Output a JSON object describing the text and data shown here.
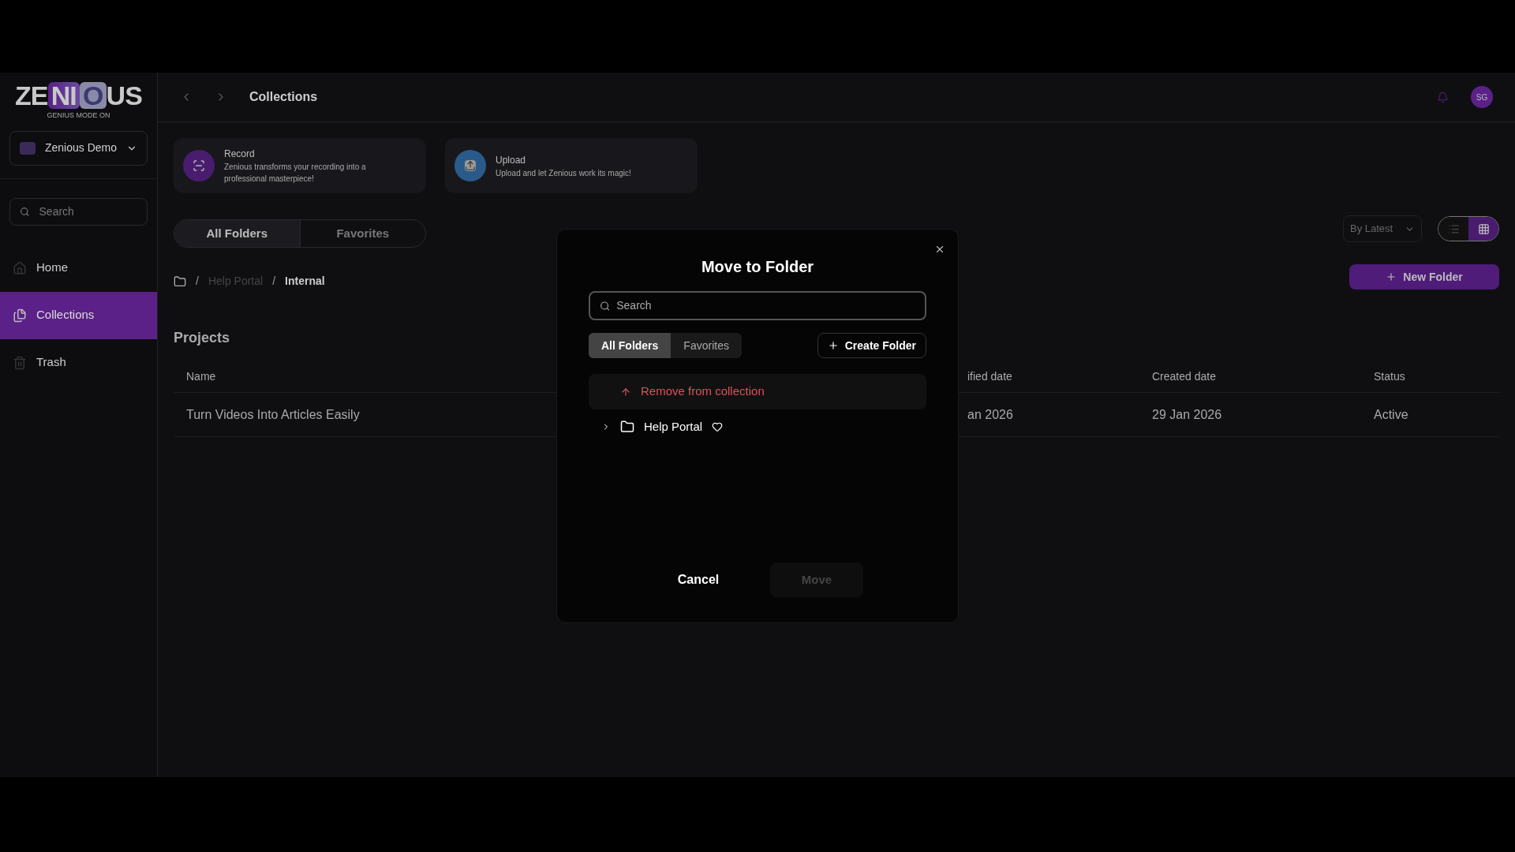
{
  "brand": {
    "name": "ZENIOUS",
    "tagline": "GENIUS MODE ON"
  },
  "workspace": {
    "name": "Zenious Demo"
  },
  "sidebar": {
    "search": {
      "placeholder": "Search"
    },
    "items": [
      {
        "label": "Home",
        "kind": "home",
        "selected": false
      },
      {
        "label": "Collections",
        "kind": "collections",
        "selected": true
      },
      {
        "label": "Trash",
        "kind": "trash",
        "selected": false
      }
    ]
  },
  "header": {
    "title": "Collections",
    "avatar": "SG"
  },
  "actions": [
    {
      "kind": "record",
      "title": "Record",
      "text": "Zenious transforms your recording into a professional masterpiece!"
    },
    {
      "kind": "upload",
      "title": "Upload",
      "text": "Upload and let Zenious work its magic!"
    }
  ],
  "folder_tabs": [
    {
      "label": "All Folders",
      "selected": true
    },
    {
      "label": "Favorites",
      "selected": false
    }
  ],
  "breadcrumb": [
    {
      "separator": "/",
      "label": "Help Portal",
      "current": false
    },
    {
      "separator": "/",
      "label": "Internal",
      "current": true
    }
  ],
  "sort": {
    "value": "By Latest"
  },
  "view_toggle": [
    {
      "kind": "list",
      "selected": false
    },
    {
      "kind": "grid",
      "selected": true
    }
  ],
  "new_folder": "New Folder",
  "section_title": "Projects",
  "table": {
    "columns": [
      "Name",
      "ified date",
      "Created date",
      "Status"
    ],
    "rows": [
      [
        "Turn Videos Into Articles Easily",
        "an 2026",
        "29 Jan 2026",
        "Active"
      ]
    ]
  },
  "modal": {
    "title": "Move to Folder",
    "search": {
      "placeholder": "Search"
    },
    "tabs": [
      {
        "label": "All Folders",
        "selected": true
      },
      {
        "label": "Favorites",
        "selected": false
      }
    ],
    "create": "Create Folder",
    "remove": "Remove from collection",
    "folders": [
      {
        "label": "Help Portal",
        "expanded": false,
        "favorite": false
      }
    ],
    "cancel": "Cancel",
    "move": {
      "label": "Move",
      "disabled": true
    }
  }
}
